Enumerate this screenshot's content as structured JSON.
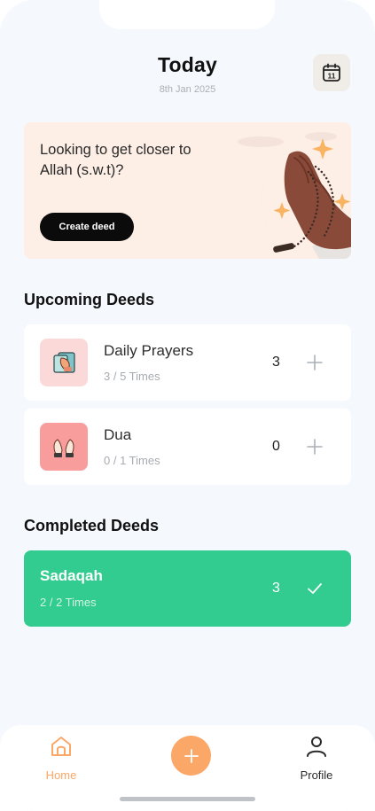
{
  "header": {
    "title": "Today",
    "date": "8th Jan 2025",
    "calendar_day": "11"
  },
  "banner": {
    "text": "Looking to get closer to Allah (s.w.t)?",
    "button_label": "Create deed"
  },
  "upcoming": {
    "title": "Upcoming Deeds",
    "items": [
      {
        "name": "Daily Prayers",
        "progress": "3 / 5 Times",
        "count": "3",
        "icon": "prayer-book-icon"
      },
      {
        "name": "Dua",
        "progress": "0 / 1 Times",
        "count": "0",
        "icon": "praying-hands-icon"
      }
    ]
  },
  "completed": {
    "title": "Completed Deeds",
    "items": [
      {
        "name": "Sadaqah",
        "progress": "2 / 2 Times",
        "count": "3",
        "icon": "check-icon"
      }
    ]
  },
  "nav": {
    "home_label": "Home",
    "profile_label": "Profile"
  },
  "colors": {
    "accent": "#fba768",
    "completed": "#33cc90",
    "background": "#f5f9fd"
  }
}
